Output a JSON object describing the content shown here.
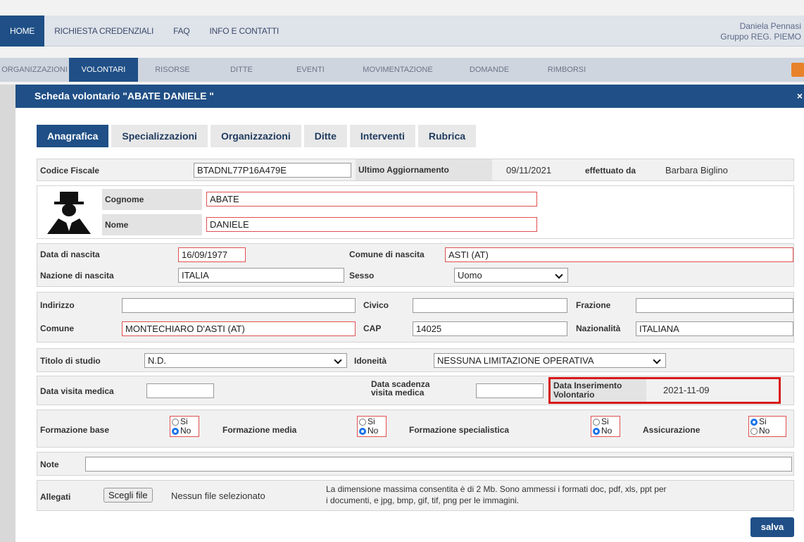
{
  "topnav": {
    "items": [
      "HOME",
      "RICHIESTA CREDENZIALI",
      "FAQ",
      "INFO E CONTATTI"
    ],
    "user_name": "Daniela Pennasi",
    "user_group": "Gruppo REG. PIEMO"
  },
  "subnav": {
    "items": [
      "ORGANIZZAZIONI",
      "VOLONTARI",
      "RISORSE",
      "DITTE",
      "EVENTI",
      "MOVIMENTAZIONE",
      "DOMANDE",
      "RIMBORSI"
    ]
  },
  "dialog": {
    "title": "Scheda volontario \"ABATE DANIELE \"",
    "close": "×"
  },
  "tabs": [
    "Anagrafica",
    "Specializzazioni",
    "Organizzazioni",
    "Ditte",
    "Interventi",
    "Rubrica"
  ],
  "form": {
    "codice_fiscale_label": "Codice Fiscale",
    "codice_fiscale": "BTADNL77P16A479E",
    "ultimo_agg_label": "Ultimo Aggiornamento",
    "ultimo_agg": "09/11/2021",
    "effettuato_label": "effettuato da",
    "effettuato": "Barbara Biglino",
    "cognome_label": "Cognome",
    "cognome": "ABATE",
    "nome_label": "Nome",
    "nome": "DANIELE",
    "data_nascita_label": "Data di nascita",
    "data_nascita": "16/09/1977",
    "comune_nascita_label": "Comune di nascita",
    "comune_nascita": "ASTI (AT)",
    "nazione_nascita_label": "Nazione di nascita",
    "nazione_nascita": "ITALIA",
    "sesso_label": "Sesso",
    "sesso": "Uomo",
    "indirizzo_label": "Indirizzo",
    "indirizzo": "",
    "civico_label": "Civico",
    "civico": "",
    "frazione_label": "Frazione",
    "frazione": "",
    "comune_label": "Comune",
    "comune": "MONTECHIARO D'ASTI (AT)",
    "cap_label": "CAP",
    "cap": "14025",
    "nazionalita_label": "Nazionalità",
    "nazionalita": "ITALIANA",
    "titolo_label": "Titolo di studio",
    "titolo": "N.D.",
    "idoneita_label": "Idoneità",
    "idoneita": "NESSUNA LIMITAZIONE OPERATIVA",
    "visita_label": "Data visita medica",
    "visita": "",
    "scadenza_label_1": "Data scadenza",
    "scadenza_label_2": "visita medica",
    "scadenza": "",
    "inserimento_label_1": "Data Inserimento",
    "inserimento_label_2": "Volontario",
    "inserimento": "2021-11-09",
    "formazione_base_label": "Formazione base",
    "formazione_media_label": "Formazione media",
    "formazione_spec_label": "Formazione specialistica",
    "assicurazione_label": "Assicurazione",
    "radio_si": "Si",
    "radio_no": "No",
    "note_label": "Note",
    "note": "",
    "allegati_label": "Allegati",
    "scegli_file": "Scegli file",
    "nessun_file": "Nessun file selezionato",
    "allegati_info_1": "La dimensione massima consentita è di 2 Mb. Sono ammessi i formati doc, pdf, xls, ppt per",
    "allegati_info_2": "i documenti, e jpg, bmp, gif, tif, png per le immagini.",
    "salva": "salva"
  },
  "colors": {
    "primary": "#1f4f86",
    "highlight": "#d81818",
    "required_border": "#e05050"
  }
}
